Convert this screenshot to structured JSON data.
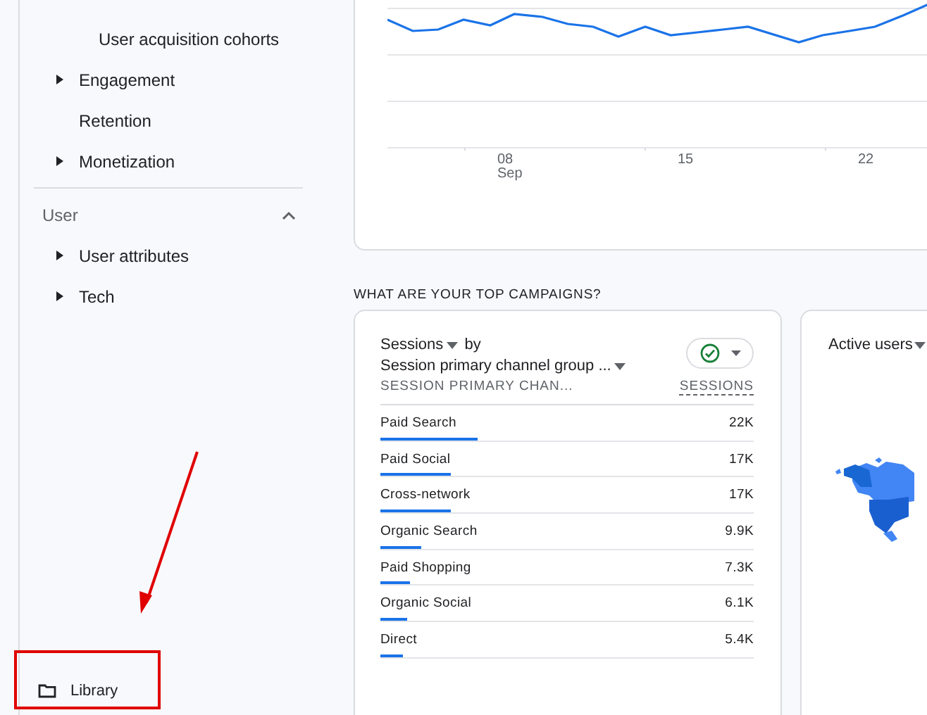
{
  "sidebar": {
    "items": [
      {
        "label": "User acquisition cohorts",
        "kind": "subitem"
      },
      {
        "label": "Engagement",
        "kind": "group",
        "expanded": false
      },
      {
        "label": "Retention",
        "kind": "link"
      },
      {
        "label": "Monetization",
        "kind": "group",
        "expanded": false
      }
    ],
    "section": {
      "title": "User",
      "expanded": true,
      "items": [
        {
          "label": "User attributes",
          "kind": "group",
          "expanded": false
        },
        {
          "label": "Tech",
          "kind": "group",
          "expanded": false
        }
      ]
    },
    "footer": {
      "label": "Library"
    }
  },
  "trend_card": {
    "x_labels": [
      {
        "day": "08",
        "month": "Sep"
      },
      {
        "day": "15"
      },
      {
        "day": "22"
      }
    ]
  },
  "section_title": "WHAT ARE YOUR TOP CAMPAIGNS?",
  "campaigns_card": {
    "metric": "Sessions",
    "by": "by",
    "dimension": "Session primary channel group ...",
    "compare_on": true,
    "columns": [
      "SESSION PRIMARY CHAN...",
      "SESSIONS"
    ],
    "rows": [
      {
        "channel": "Paid Search",
        "sessions": "22K",
        "level": 0.26
      },
      {
        "channel": "Paid Social",
        "sessions": "17K",
        "level": 0.19
      },
      {
        "channel": "Cross-network",
        "sessions": "17K",
        "level": 0.19
      },
      {
        "channel": "Organic Search",
        "sessions": "9.9K",
        "level": 0.11
      },
      {
        "channel": "Paid Shopping",
        "sessions": "7.3K",
        "level": 0.08
      },
      {
        "channel": "Organic Social",
        "sessions": "6.1K",
        "level": 0.07
      },
      {
        "channel": "Direct",
        "sessions": "5.4K",
        "level": 0.06
      }
    ]
  },
  "users_card": {
    "metric": "Active users"
  }
}
